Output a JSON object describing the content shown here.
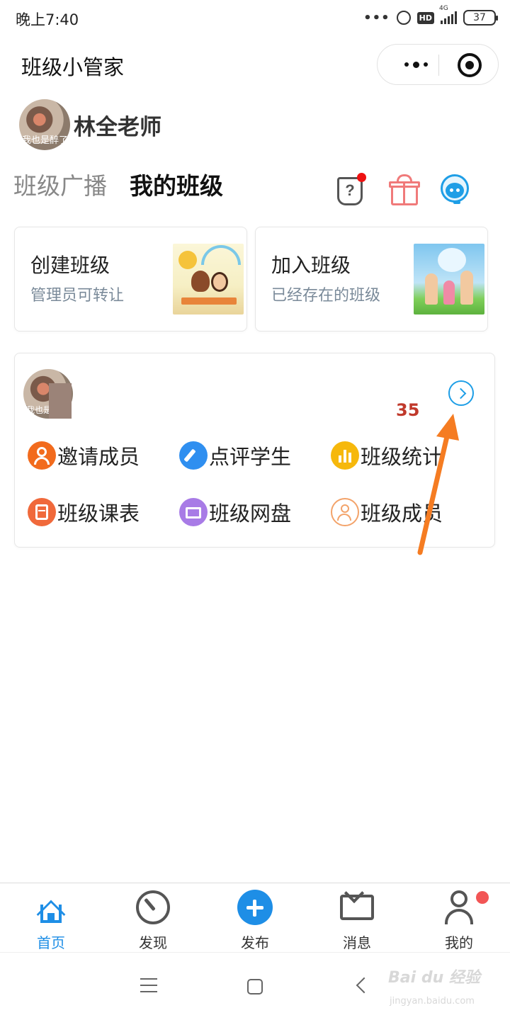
{
  "status_bar": {
    "time": "晚上7:40",
    "hd": "HD",
    "network": "4G",
    "battery": "37"
  },
  "header": {
    "app_title": "班级小管家"
  },
  "profile": {
    "avatar_caption": "我也是醉了",
    "teacher_name": "林全老师"
  },
  "tabs": [
    {
      "label": "班级广播",
      "active": false
    },
    {
      "label": "我的班级",
      "active": true
    }
  ],
  "action_cards": [
    {
      "title": "创建班级",
      "subtitle": "管理员可转让"
    },
    {
      "title": "加入班级",
      "subtitle": "已经存在的班级"
    }
  ],
  "class_card": {
    "avatar_caption": "我也是",
    "member_count": "35",
    "features": [
      {
        "label": "邀请成员",
        "icon": "invite-member-icon",
        "color": "#f26b1d"
      },
      {
        "label": "点评学生",
        "icon": "review-student-icon",
        "color": "#2f8ff0"
      },
      {
        "label": "班级统计",
        "icon": "class-stats-icon",
        "color": "#f6b80c"
      },
      {
        "label": "班级课表",
        "icon": "class-schedule-icon",
        "color": "#f0693b"
      },
      {
        "label": "班级网盘",
        "icon": "class-disk-icon",
        "color": "#a87be6"
      },
      {
        "label": "班级成员",
        "icon": "class-members-icon",
        "color": "#f3a36a"
      }
    ]
  },
  "tabbar": {
    "items": [
      {
        "label": "首页",
        "icon": "home-icon",
        "active": true
      },
      {
        "label": "发现",
        "icon": "discover-icon",
        "active": false
      },
      {
        "label": "发布",
        "icon": "publish-icon",
        "active": false
      },
      {
        "label": "消息",
        "icon": "message-icon",
        "active": false
      },
      {
        "label": "我的",
        "icon": "profile-icon",
        "active": false
      }
    ]
  },
  "watermark": {
    "brand": "Bai du 经验",
    "url": "jingyan.baidu.com"
  },
  "colors": {
    "accent": "#1e8ee6",
    "annotation_arrow": "#f57c22",
    "badge_red": "#ee1111",
    "member_count": "#c0392b"
  }
}
